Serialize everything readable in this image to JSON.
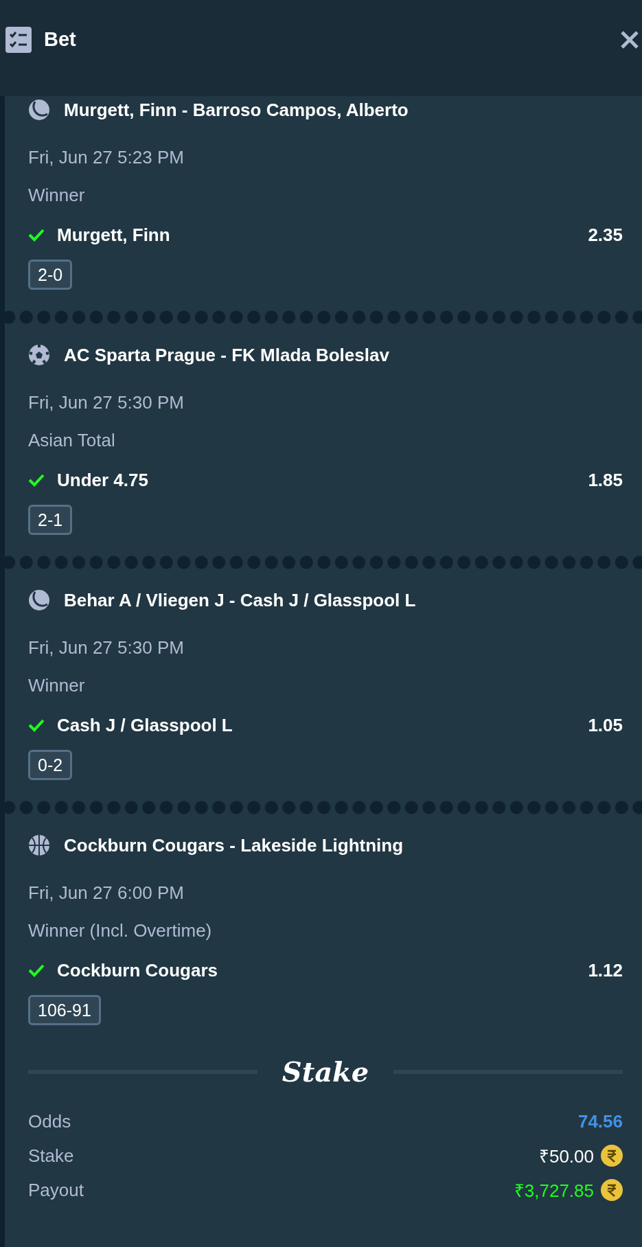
{
  "header": {
    "title": "Bet"
  },
  "legs": [
    {
      "kind": "tennis",
      "event": "Murgett, Finn - Barroso Campos, Alberto",
      "date": "Fri, Jun 27 5:23 PM",
      "market": "Winner",
      "selection": "Murgett, Finn",
      "won": true,
      "odds": "2.35",
      "score": "2-0"
    },
    {
      "kind": "soccer",
      "event": "AC Sparta Prague - FK Mlada Boleslav",
      "date": "Fri, Jun 27 5:30 PM",
      "market": "Asian Total",
      "selection": "Under 4.75",
      "won": true,
      "odds": "1.85",
      "score": "2-1"
    },
    {
      "kind": "tennis",
      "event": "Behar A / Vliegen J - Cash J / Glasspool L",
      "date": "Fri, Jun 27 5:30 PM",
      "market": "Winner",
      "selection": "Cash J / Glasspool L",
      "won": true,
      "odds": "1.05",
      "score": "0-2"
    },
    {
      "kind": "basketball",
      "event": "Cockburn Cougars - Lakeside Lightning",
      "date": "Fri, Jun 27 6:00 PM",
      "market": "Winner (Incl. Overtime)",
      "selection": "Cockburn Cougars",
      "won": true,
      "odds": "1.12",
      "score": "106-91"
    }
  ],
  "brand": "Stake",
  "summary": [
    {
      "kind": "odds",
      "label": "Odds",
      "value": "74.56"
    },
    {
      "kind": "stake",
      "label": "Stake",
      "value": "₹50.00"
    },
    {
      "kind": "payout",
      "label": "Payout",
      "value": "₹3,727.85"
    }
  ]
}
